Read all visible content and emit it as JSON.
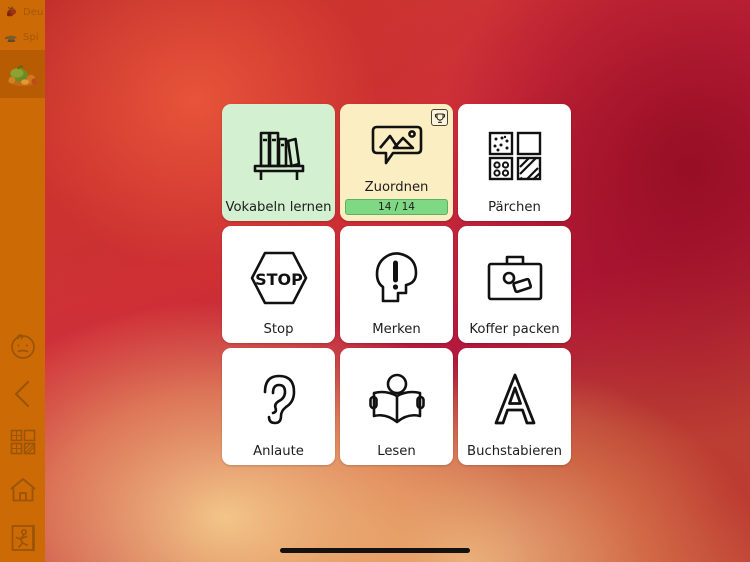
{
  "app": {
    "background_colors": {
      "red": "#c9362f",
      "crimson": "#b0183c",
      "amber": "#efc184",
      "sidebar_orange": "#cc6a05",
      "sidebar_selected": "#b85c03"
    }
  },
  "sidebar": {
    "categories": [
      {
        "label": "Deu",
        "icon": "berry-icon",
        "selected": false
      },
      {
        "label": "Spi",
        "icon": "hedgehog-icon",
        "selected": false
      },
      {
        "label": "",
        "icon": "vegetables-icon",
        "selected": true
      }
    ],
    "actions": [
      {
        "name": "help-face-icon",
        "label": "Hilfe"
      },
      {
        "name": "back-chevron-icon",
        "label": "Zurück"
      },
      {
        "name": "grid-tiles-icon",
        "label": "Übersicht"
      },
      {
        "name": "home-icon",
        "label": "Start"
      },
      {
        "name": "exit-icon",
        "label": "Beenden"
      }
    ]
  },
  "grid": {
    "tiles": [
      {
        "label": "Vokabeln lernen",
        "icon": "bookshelf-icon",
        "style": "green",
        "progress": null,
        "badge": null
      },
      {
        "label": "Zuordnen",
        "icon": "picture-speech-bubble-icon",
        "style": "yellow",
        "progress": "14 / 14",
        "badge": "trophy-icon"
      },
      {
        "label": "Pärchen",
        "icon": "memory-pairs-icon",
        "style": "white",
        "progress": null,
        "badge": null
      },
      {
        "label": "Stop",
        "icon": "stop-sign-icon",
        "style": "white",
        "progress": null,
        "badge": null
      },
      {
        "label": "Merken",
        "icon": "head-exclamation-icon",
        "style": "white",
        "progress": null,
        "badge": null
      },
      {
        "label": "Koffer packen",
        "icon": "suitcase-icon",
        "style": "white",
        "progress": null,
        "badge": null
      },
      {
        "label": "Anlaute",
        "icon": "ear-icon",
        "style": "white",
        "progress": null,
        "badge": null
      },
      {
        "label": "Lesen",
        "icon": "person-reading-icon",
        "style": "white",
        "progress": null,
        "badge": null
      },
      {
        "label": "Buchstabieren",
        "icon": "letter-a-icon",
        "style": "white",
        "progress": null,
        "badge": null
      }
    ]
  },
  "stop_sign_text": "STOP",
  "letter_a_text": "A"
}
